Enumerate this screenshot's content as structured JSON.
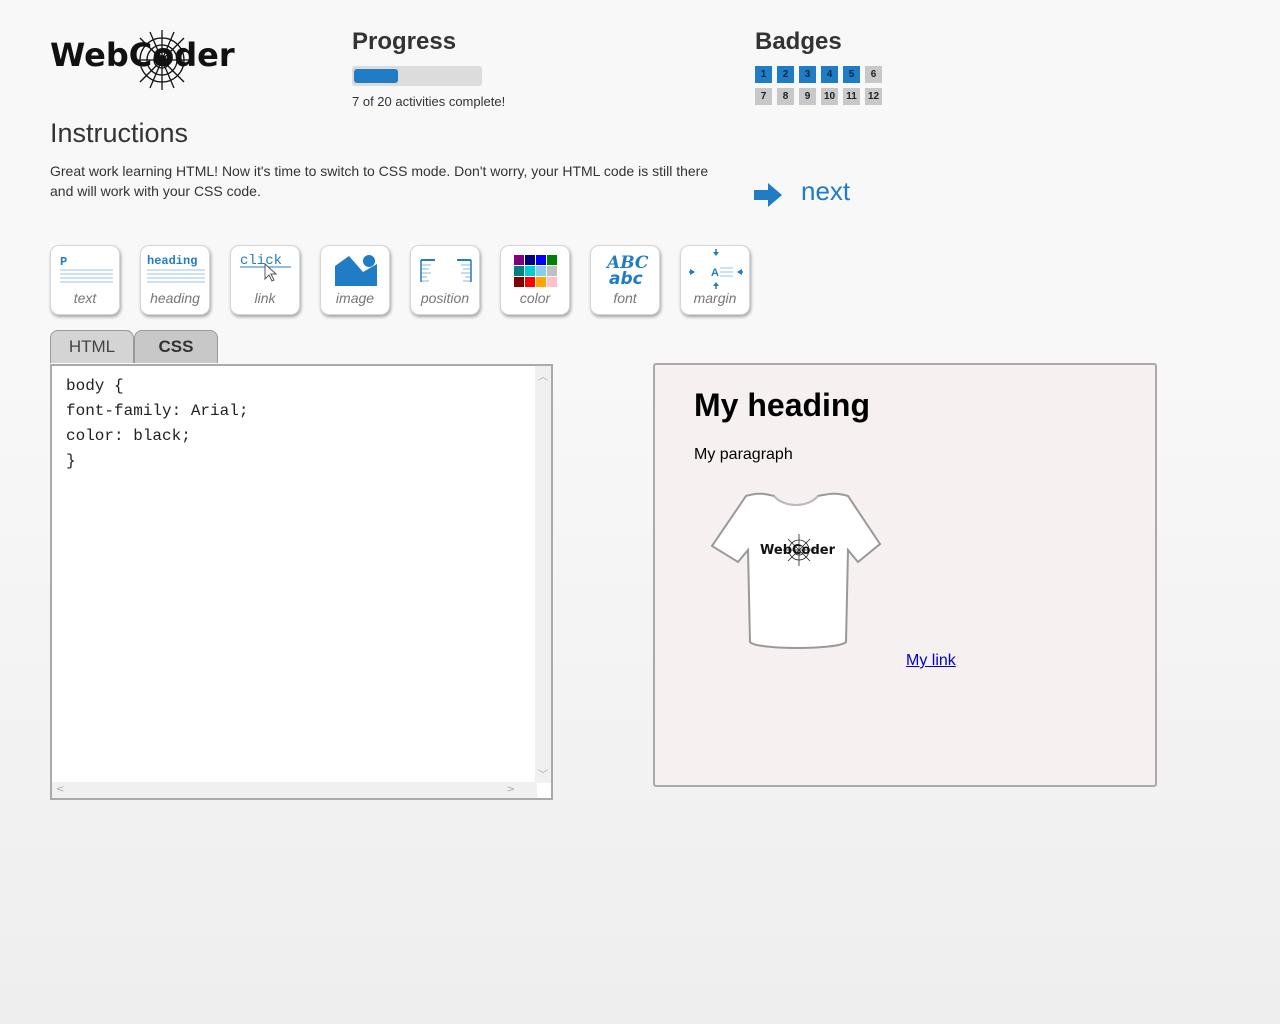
{
  "logo": {
    "text": "WebCoder"
  },
  "progress": {
    "title": "Progress",
    "completed": 7,
    "total": 20,
    "fraction": 0.35,
    "text": "7 of 20 activities complete!",
    "color": "#1f7cc5"
  },
  "badges": {
    "title": "Badges",
    "items": [
      {
        "label": "1",
        "earned": true
      },
      {
        "label": "2",
        "earned": true
      },
      {
        "label": "3",
        "earned": true
      },
      {
        "label": "4",
        "earned": true
      },
      {
        "label": "5",
        "earned": true
      },
      {
        "label": "6",
        "earned": false
      },
      {
        "label": "7",
        "earned": false
      },
      {
        "label": "8",
        "earned": false
      },
      {
        "label": "9",
        "earned": false
      },
      {
        "label": "10",
        "earned": false
      },
      {
        "label": "11",
        "earned": false
      },
      {
        "label": "12",
        "earned": false
      }
    ],
    "earned_color": "#1f7cc5",
    "unearned_color": "#c8c8c8"
  },
  "instructions": {
    "title": "Instructions",
    "text": "Great work learning HTML! Now it's time to switch to CSS mode. Don't worry, your HTML code is still there and will work with your CSS code."
  },
  "next": {
    "label": "next",
    "icon": "arrow-right-icon"
  },
  "tools": [
    {
      "label": "text",
      "icon": "text-icon",
      "glyph": "P"
    },
    {
      "label": "heading",
      "icon": "heading-icon",
      "glyph": "heading"
    },
    {
      "label": "link",
      "icon": "link-icon",
      "glyph": "click"
    },
    {
      "label": "image",
      "icon": "image-icon"
    },
    {
      "label": "position",
      "icon": "position-icon"
    },
    {
      "label": "color",
      "icon": "color-icon"
    },
    {
      "label": "font",
      "icon": "font-icon",
      "glyph_top": "ABC",
      "glyph_bottom": "abc"
    },
    {
      "label": "margin",
      "icon": "margin-icon",
      "glyph": "A"
    }
  ],
  "tabs": {
    "html": "HTML",
    "css": "CSS",
    "active": "CSS"
  },
  "editor": {
    "code": "body {\nfont-family: Arial;\ncolor: black;\n}"
  },
  "preview": {
    "heading": "My heading",
    "paragraph": "My paragraph",
    "image_text": "WebCoder",
    "link": "My link"
  }
}
